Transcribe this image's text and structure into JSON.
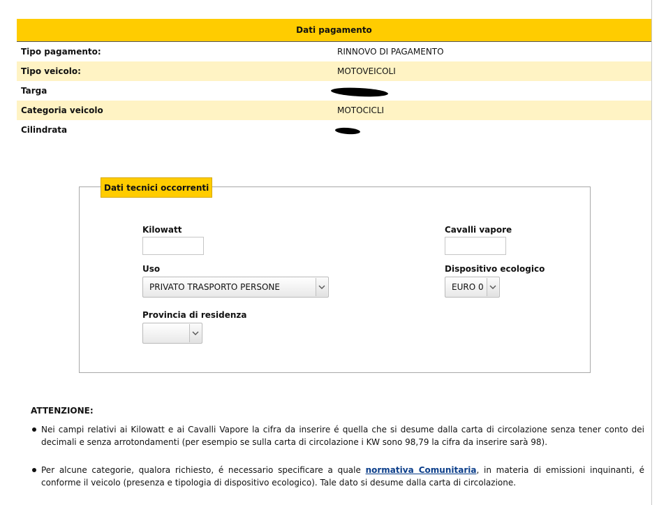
{
  "payment": {
    "header": "Dati pagamento",
    "rows": [
      {
        "label": "Tipo pagamento:",
        "value": "RINNOVO DI PAGAMENTO"
      },
      {
        "label": "Tipo veicolo:",
        "value": "MOTOVEICOLI"
      },
      {
        "label": "Targa",
        "value": ""
      },
      {
        "label": "Categoria veicolo",
        "value": "MOTOCICLI"
      },
      {
        "label": "Cilindrata",
        "value": ""
      }
    ]
  },
  "technical": {
    "legend": "Dati tecnici occorrenti",
    "kilowatt_label": "Kilowatt",
    "kilowatt_value": "",
    "cavalli_label": "Cavalli vapore",
    "cavalli_value": "",
    "uso_label": "Uso",
    "uso_selected": "PRIVATO TRASPORTO PERSONE",
    "dispositivo_label": "Dispositivo ecologico",
    "dispositivo_selected": "EURO 0",
    "provincia_label": "Provincia di residenza",
    "provincia_selected": ""
  },
  "attention": {
    "title": "ATTENZIONE:",
    "note1": "Nei campi relativi ai Kilowatt e ai Cavalli Vapore la cifra da inserire é quella che si desume dalla carta di circolazione senza tener conto dei decimali e senza arrotondamenti (per esempio se sulla carta di circolazione i KW sono 98,79 la cifra da inserire sarà 98).",
    "note2_before": "Per alcune categorie, qualora richiesto, é necessario specificare a quale ",
    "note2_link": "normativa Comunitaria",
    "note2_after": ", in materia di emissioni inquinanti, é conforme il veicolo (presenza e tipologia di dispositivo ecologico). Tale dato si desume dalla carta di circolazione."
  },
  "colors": {
    "accent": "#ffcc00",
    "row_alt": "#fff3c4",
    "link": "#0b3e8a"
  },
  "icons": {
    "dropdown": "chevron-down-icon"
  }
}
